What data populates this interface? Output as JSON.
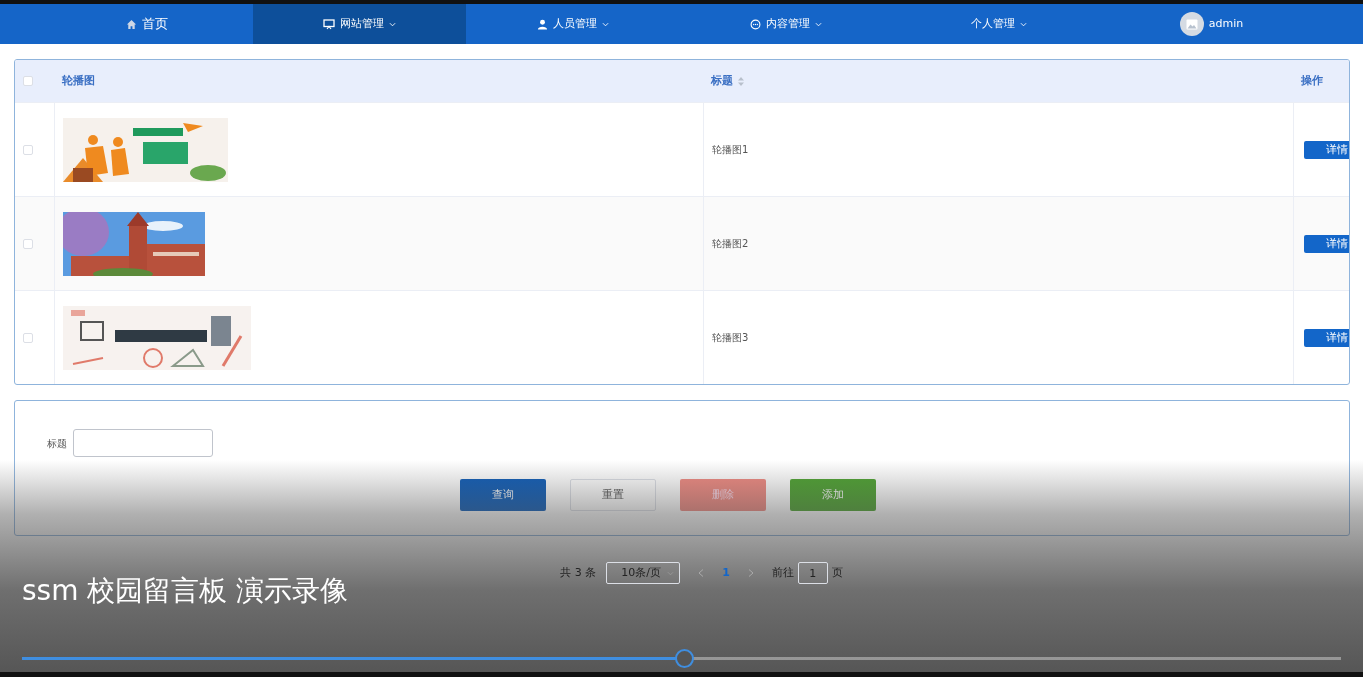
{
  "nav": {
    "items": [
      {
        "label": "首页",
        "dropdown": false,
        "selected": false
      },
      {
        "label": "网站管理",
        "dropdown": true,
        "selected": true
      },
      {
        "label": "人员管理",
        "dropdown": true,
        "selected": false
      },
      {
        "label": "内容管理",
        "dropdown": true,
        "selected": false
      },
      {
        "label": "个人管理",
        "dropdown": true,
        "selected": false
      }
    ],
    "user": "admin"
  },
  "table": {
    "select_all_checked": false,
    "columns": [
      {
        "label": "轮播图",
        "sortable": false
      },
      {
        "label": "标题",
        "sortable": true
      },
      {
        "label": "操作",
        "sortable": false
      }
    ],
    "rows": [
      {
        "checked": false,
        "title": "轮播图1",
        "action": "详情"
      },
      {
        "checked": false,
        "title": "轮播图2",
        "action": "详情"
      },
      {
        "checked": false,
        "title": "轮播图3",
        "action": "详情"
      }
    ]
  },
  "search": {
    "label": "标题",
    "buttons": [
      {
        "label": "查询",
        "kind": "primary"
      },
      {
        "label": "重置",
        "kind": "default"
      },
      {
        "label": "删除",
        "kind": "danger"
      },
      {
        "label": "添加",
        "kind": "success"
      }
    ]
  },
  "pagination": {
    "total": "共 3 条",
    "page_size": "10条/页",
    "pages": [
      {
        "label": "1",
        "selected": true
      }
    ],
    "goto_label": "前往",
    "goto_value": "1",
    "goto_suffix": "页"
  },
  "video": {
    "caption": "ssm 校园留言板 演示录像",
    "progress": {
      "level": 0.502
    }
  }
}
